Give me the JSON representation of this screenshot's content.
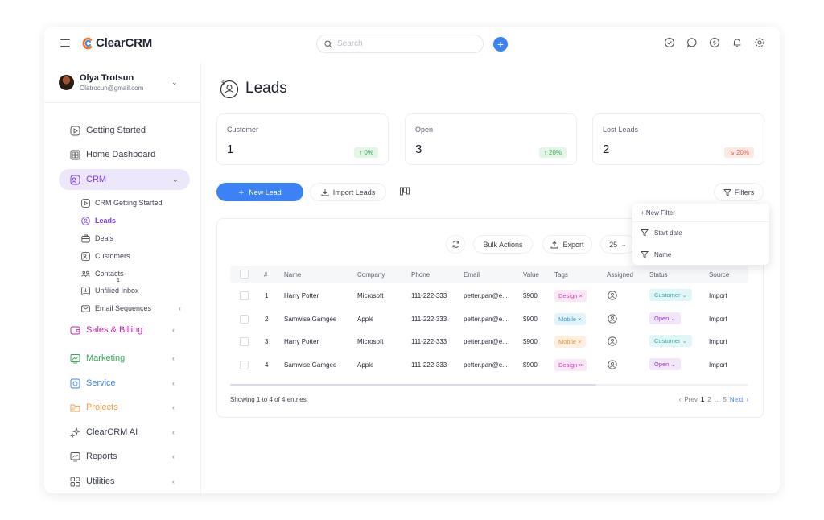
{
  "app": {
    "name": "ClearCRM"
  },
  "topbar": {
    "search_placeholder": "Search"
  },
  "user": {
    "name": "Olya Trotsun",
    "email": "Olatrocun@gmail.com"
  },
  "sidebar": {
    "items": [
      {
        "label": "Getting Started"
      },
      {
        "label": "Home Dashboard"
      },
      {
        "label": "CRM"
      },
      {
        "label": "Sales & Billing"
      },
      {
        "label": "Marketing"
      },
      {
        "label": "Service"
      },
      {
        "label": "Projects"
      },
      {
        "label": "ClearCRM AI"
      },
      {
        "label": "Reports"
      },
      {
        "label": "Utilities"
      }
    ],
    "crm_sub": [
      {
        "label": "CRM Getting Started"
      },
      {
        "label": "Leads"
      },
      {
        "label": "Deals"
      },
      {
        "label": "Customers"
      },
      {
        "label": "Contacts"
      },
      {
        "label": "Unfilied Inbox"
      },
      {
        "label": "Email Sequences"
      }
    ],
    "inbox_count": "1",
    "colors": {
      "crm": "#7c3aed",
      "sales": "#c026a3",
      "marketing": "#3aa659",
      "service": "#3b82f6",
      "projects": "#f59e42"
    }
  },
  "page": {
    "title": "Leads"
  },
  "stats": [
    {
      "label": "Customer",
      "value": "1",
      "badge": "↑ 0%"
    },
    {
      "label": "Open",
      "value": "3",
      "badge": "↑ 20%"
    },
    {
      "label": "Lost Leads",
      "value": "2",
      "badge": "↘ 20%"
    }
  ],
  "actions": {
    "new_lead": "New Lead",
    "import_leads": "Import Leads",
    "filters": "Filters"
  },
  "toolbar": {
    "bulk_actions": "Bulk Actions",
    "export": "Export",
    "page_size": "25"
  },
  "table": {
    "columns": [
      "#",
      "Name",
      "Company",
      "Phone",
      "Email",
      "Value",
      "Tags",
      "Assigned",
      "Status",
      "Source"
    ],
    "rows": [
      {
        "num": "1",
        "name": "Harry Potter",
        "company": "Microsoft",
        "phone": "111-222-333",
        "email": "petter.pan@e...",
        "value": "$900",
        "tag": "Design",
        "status": "Customer",
        "source": "Import"
      },
      {
        "num": "2",
        "name": "Samwise Gamgee",
        "company": "Apple",
        "phone": "111-222-333",
        "email": "petter.pan@e...",
        "value": "$900",
        "tag": "Mobile",
        "status": "Open",
        "source": "Import"
      },
      {
        "num": "3",
        "name": "Harry Potter",
        "company": "Microsoft",
        "phone": "111-222-333",
        "email": "petter.pan@e...",
        "value": "$900",
        "tag": "Mobile",
        "status": "Customer",
        "source": "Import"
      },
      {
        "num": "4",
        "name": "Samwise Gamgee",
        "company": "Apple",
        "phone": "111-222-333",
        "email": "petter.pan@e...",
        "value": "$900",
        "tag": "Design",
        "status": "Open",
        "source": "Import"
      }
    ]
  },
  "footer": {
    "entries": "Showing 1 to 4 of 4 entries",
    "prev": "Prev",
    "p1": "1",
    "p2": "2",
    "ellipsis": "...",
    "p5": "5",
    "next": "Next"
  },
  "filter_menu": {
    "new_filter": "New Filter",
    "items": [
      "Start date",
      "Name"
    ]
  }
}
